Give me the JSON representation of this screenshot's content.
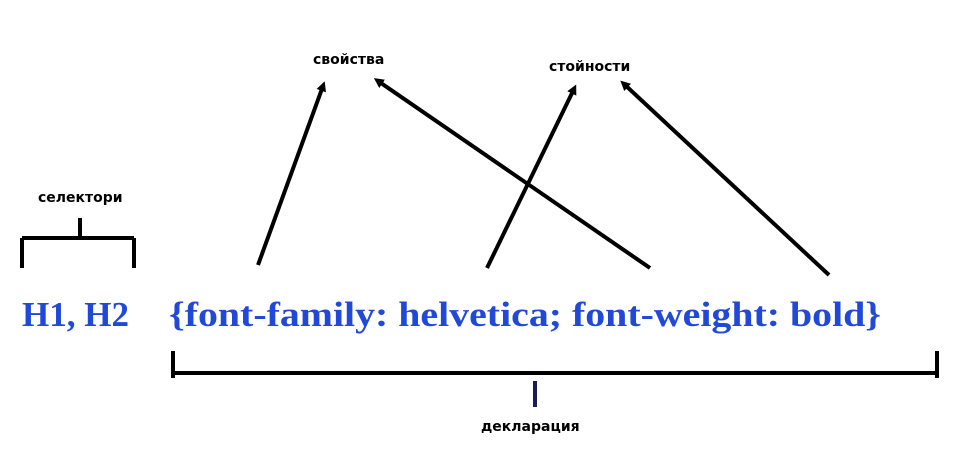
{
  "labels": {
    "properties": "свойства",
    "values": "стойности",
    "selectors": "селектори",
    "declaration": "декларация"
  },
  "code": {
    "selectors": "H1, H2",
    "declaration": "{font-family: helvetica; font-weight: bold}"
  },
  "colors": {
    "code": "#2049d8",
    "lines": "#000000"
  }
}
